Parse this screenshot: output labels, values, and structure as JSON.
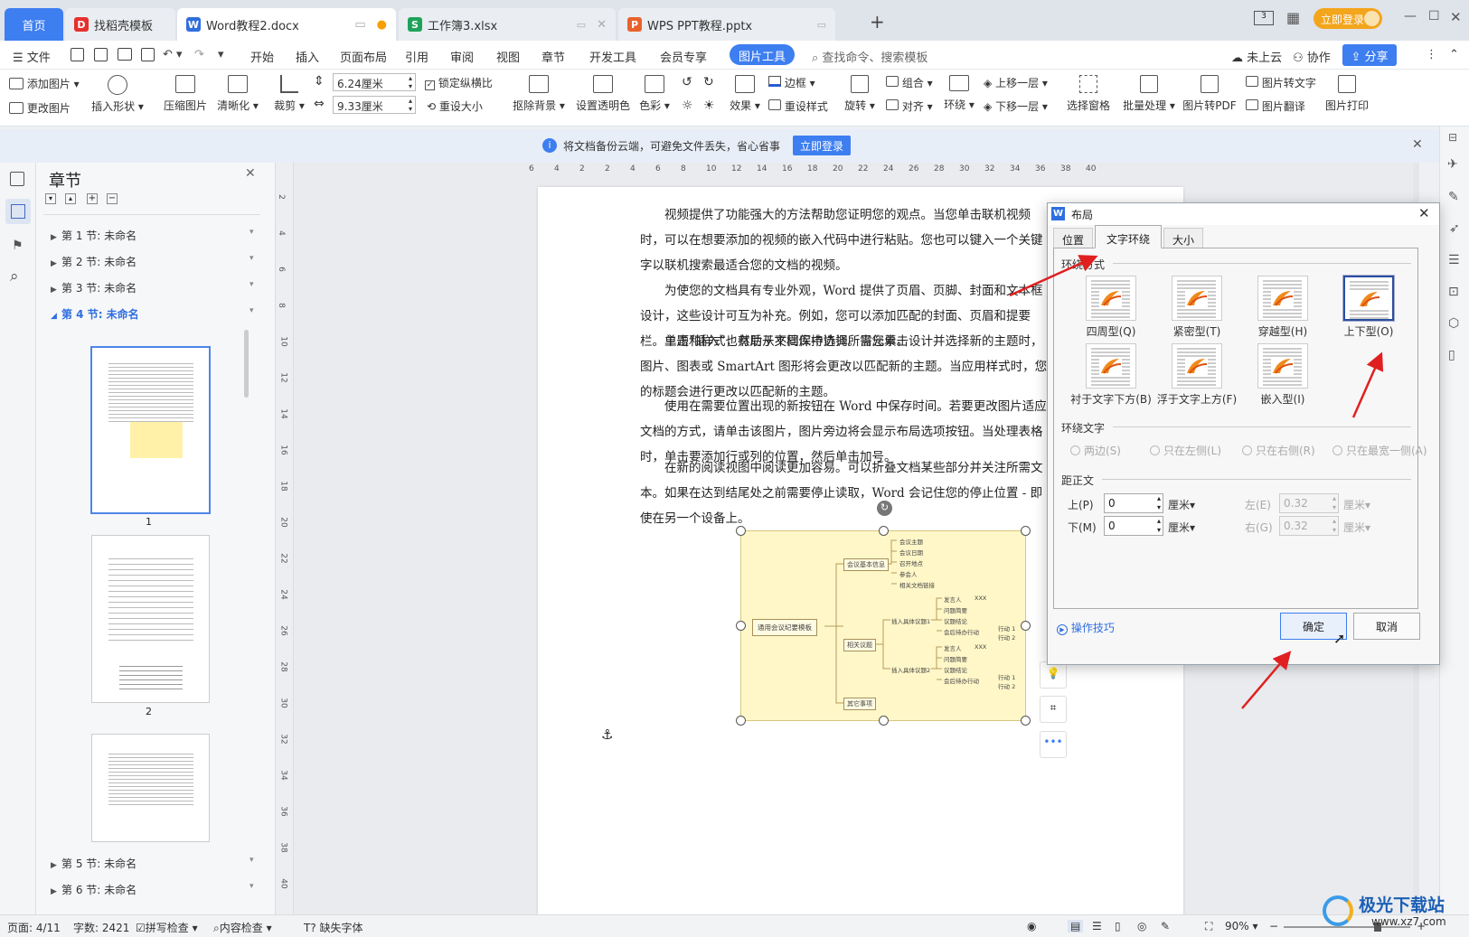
{
  "tabs": [
    {
      "label": "首页",
      "active": true
    },
    {
      "label": "找稻壳模板"
    },
    {
      "label": "Word教程2.docx"
    },
    {
      "label": "工作簿3.xlsx"
    },
    {
      "label": "WPS PPT教程.pptx"
    }
  ],
  "titlebar": {
    "login": "立即登录"
  },
  "menu": {
    "file": "文件",
    "items": [
      "开始",
      "插入",
      "页面布局",
      "引用",
      "审阅",
      "视图",
      "章节",
      "开发工具",
      "会员专享"
    ],
    "active": "图片工具",
    "search": "查找命令、搜索模板",
    "cloud": "未上云",
    "collab": "协作",
    "share": "分享"
  },
  "ribbon": {
    "add_image": "添加图片",
    "change_image": "更改图片",
    "insert_shape": "插入形状",
    "compress": "压缩图片",
    "clarify": "清晰化",
    "crop": "裁剪",
    "width": "6.24厘米",
    "height": "9.33厘米",
    "lock_ratio": "锁定纵横比",
    "reset_size": "重设大小",
    "remove_bg": "抠除背景",
    "transparent": "设置透明色",
    "color": "色彩",
    "effect": "效果",
    "border": "边框",
    "reset_style": "重设样式",
    "rotate": "旋转",
    "combine": "组合",
    "align": "对齐",
    "wrap": "环绕",
    "up_layer": "上移一层",
    "down_layer": "下移一层",
    "select_pane": "选择窗格",
    "batch": "批量处理",
    "to_pdf": "图片转PDF",
    "to_text": "图片转文字",
    "translate": "图片翻译",
    "print": "图片打印"
  },
  "notice": {
    "text": "将文档备份云端，可避免文件丢失，省心省事",
    "button": "立即登录"
  },
  "nav": {
    "title": "章节",
    "sections": [
      "第 1 节: 未命名",
      "第 2 节: 未命名",
      "第 3 节: 未命名",
      "第 4 节: 未命名",
      "第 5 节: 未命名",
      "第 6 节: 未命名"
    ],
    "page1": "1",
    "page2": "2"
  },
  "ruler": {
    "ticks": [
      "6",
      "4",
      "2",
      "2",
      "4",
      "6",
      "8",
      "10",
      "12",
      "14",
      "16",
      "18",
      "20",
      "22",
      "24",
      "26",
      "28",
      "30",
      "32",
      "34",
      "36",
      "38",
      "40"
    ],
    "vticks": [
      "2",
      "4",
      "6",
      "8",
      "10",
      "12",
      "14",
      "16",
      "18",
      "20",
      "22",
      "24",
      "26",
      "28",
      "30",
      "32",
      "34",
      "36",
      "38",
      "40"
    ]
  },
  "doc": {
    "paragraphs": [
      "视频提供了功能强大的方法帮助您证明您的观点。当您单击联机视频时，可以在想要添加的视频的嵌入代码中进行粘贴。您也可以键入一个关键字以联机搜索最适合您的文档的视频。",
      "为使您的文档具有专业外观，Word 提供了页眉、页脚、封面和文本框设计，这些设计可互为补充。例如，您可以添加匹配的封面、页眉和提要栏。单击“插入”，然后从不同库中选择所需元素。",
      "主题和样式也有助于文档保持协调。当您单击设计并选择新的主题时，图片、图表或 SmartArt 图形将会更改以匹配新的主题。当应用样式时，您的标题会进行更改以匹配新的主题。",
      "使用在需要位置出现的新按钮在 Word 中保存时间。若要更改图片适应文档的方式，请单击该图片，图片旁边将会显示布局选项按钮。当处理表格时，单击要添加行或列的位置，然后单击加号。",
      "在新的阅读视图中阅读更加容易。可以折叠文档某些部分并关注所需文本。如果在达到结尾处之前需要停止读取，Word 会记住您的停止位置 - 即使在另一个设备上。"
    ]
  },
  "mindmap": {
    "root": "通用会议纪要模板",
    "b1": "会议基本信息",
    "b2": "相关议题",
    "b3": "其它事项",
    "l1": [
      "会议主题",
      "会议日期",
      "召开地点",
      "参会人",
      "相关文档链接"
    ],
    "t1": "插入具体议题1",
    "t2": "插入具体议题2",
    "s": [
      "发言人",
      "问题简要",
      "议题结论",
      "会后待办行动"
    ],
    "xxx": "XXX",
    "act": [
      "行动 1",
      "行动 2"
    ]
  },
  "dialog": {
    "title": "布局",
    "tabs": [
      "位置",
      "文字环绕",
      "大小"
    ],
    "active_tab": "文字环绕",
    "wrap_style_label": "环绕方式",
    "styles": [
      "四周型(Q)",
      "紧密型(T)",
      "穿越型(H)",
      "上下型(O)",
      "衬于文字下方(B)",
      "浮于文字上方(F)",
      "嵌入型(I)"
    ],
    "selected_style": "上下型(O)",
    "wrap_text_label": "环绕文字",
    "wrap_text": [
      "两边(S)",
      "只在左侧(L)",
      "只在右侧(R)",
      "只在最宽一侧(A)"
    ],
    "distance_label": "距正文",
    "top_label": "上(P)",
    "top": "0",
    "bottom_label": "下(M)",
    "bottom": "0",
    "left_label": "左(E)",
    "left": "0.32",
    "right_label": "右(G)",
    "right": "0.32",
    "unit": "厘米",
    "tips": "操作技巧",
    "ok": "确定",
    "cancel": "取消"
  },
  "status": {
    "page": "页面: 4/11",
    "words": "字数: 2421",
    "spell": "拼写检查",
    "content": "内容检查",
    "font": "缺失字体",
    "zoom": "90%"
  },
  "watermark": {
    "main": "极光下载站",
    "sub": "www.xz7.com"
  },
  "colors": {
    "accent": "#2f7ae5",
    "tab_bg": "#dfe3ea",
    "arrow": "#e02020"
  }
}
